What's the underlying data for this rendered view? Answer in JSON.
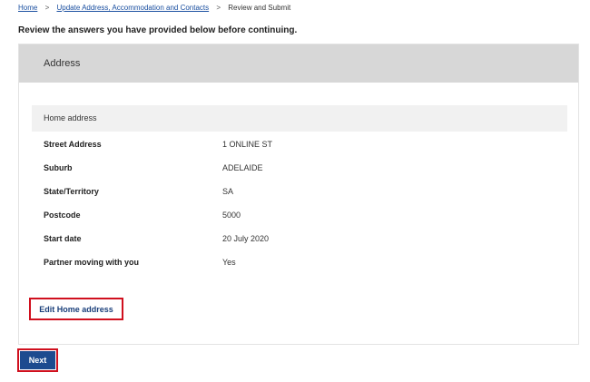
{
  "breadcrumb": {
    "home": "Home",
    "sep": ">",
    "update": "Update Address, Accommodation and Contacts",
    "current": "Review and Submit"
  },
  "intro": "Review the answers you have provided below before continuing.",
  "section": {
    "title": "Address",
    "subtitle": "Home address",
    "rows": [
      {
        "label": "Street Address",
        "value": "1 ONLINE ST"
      },
      {
        "label": "Suburb",
        "value": "ADELAIDE"
      },
      {
        "label": "State/Territory",
        "value": "SA"
      },
      {
        "label": "Postcode",
        "value": "5000"
      },
      {
        "label": "Start date",
        "value": "20 July 2020"
      },
      {
        "label": "Partner moving with you",
        "value": "Yes"
      }
    ],
    "edit_label": "Edit Home address"
  },
  "next_label": "Next",
  "colors": {
    "highlight": "#d0101e",
    "primary": "#1d4b8f",
    "link": "#1a4fa0"
  }
}
